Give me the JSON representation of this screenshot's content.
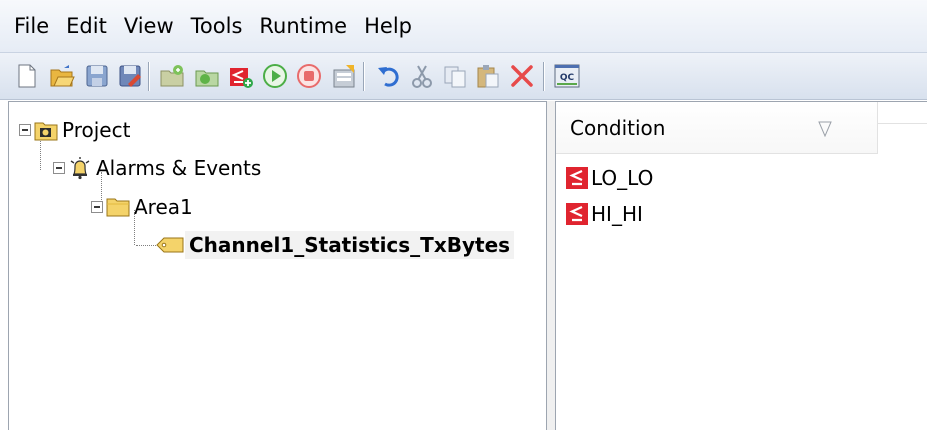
{
  "menu": {
    "file": "File",
    "edit": "Edit",
    "view": "View",
    "tools": "Tools",
    "runtime": "Runtime",
    "help": "Help"
  },
  "toolbar": {
    "icons": [
      "new-icon",
      "open-icon",
      "save-icon",
      "save-as-icon",
      "new-folder-icon",
      "new-area-icon",
      "new-condition-icon",
      "start-runtime-icon",
      "stop-runtime-icon",
      "properties-icon",
      "undo-icon",
      "cut-icon",
      "copy-icon",
      "paste-icon",
      "delete-icon",
      "quick-client-icon"
    ],
    "qc_label": "QC"
  },
  "tree": {
    "project": "Project",
    "alarms_events": "Alarms & Events",
    "area": "Area1",
    "channel": "Channel1_Statistics_TxBytes"
  },
  "condition_list": {
    "header": "Condition",
    "items": [
      "LO_LO",
      "HI_HI"
    ]
  },
  "colors": {
    "condition_icon": "#e0242f",
    "folder_fill": "#f4d36a",
    "accent_green": "#2fa84a"
  }
}
